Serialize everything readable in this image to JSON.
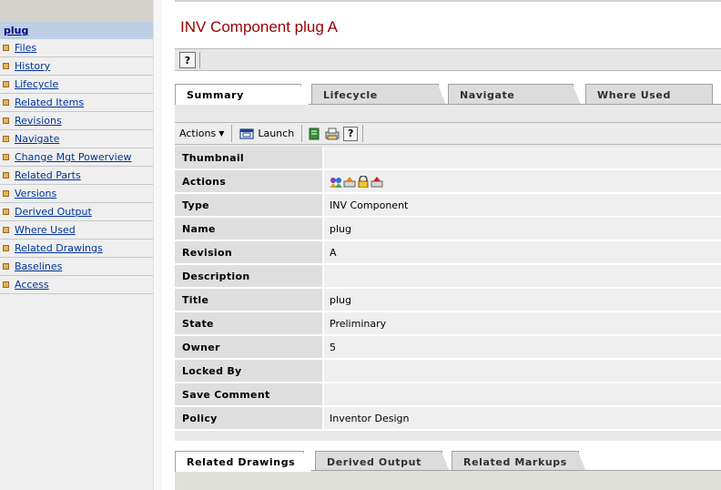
{
  "sidebar": {
    "object_link": "plug",
    "items": [
      {
        "label": "Files"
      },
      {
        "label": "History"
      },
      {
        "label": "Lifecycle"
      },
      {
        "label": "Related Items "
      },
      {
        "label": "Revisions"
      },
      {
        "label": "Navigate"
      },
      {
        "label": "Change Mgt Powerview"
      },
      {
        "label": "Related Parts"
      },
      {
        "label": "Versions"
      },
      {
        "label": "Derived Output"
      },
      {
        "label": "Where Used"
      },
      {
        "label": "Related Drawings"
      },
      {
        "label": "Baselines"
      },
      {
        "label": "Access"
      }
    ]
  },
  "page": {
    "title": "INV Component plug A",
    "help_icon": "help-icon"
  },
  "top_tabs": [
    {
      "label": "Summary",
      "active": true
    },
    {
      "label": "Lifecycle",
      "active": false
    },
    {
      "label": "Navigate",
      "active": false
    },
    {
      "label": "Where Used",
      "active": false
    }
  ],
  "action_bar": {
    "actions_label": "Actions",
    "launch_label": "Launch",
    "icons": [
      "bookmark-icon",
      "print-icon",
      "help-icon"
    ]
  },
  "properties": [
    {
      "label": "Thumbnail",
      "value": ""
    },
    {
      "label": "Actions",
      "value": ""
    },
    {
      "label": "Type",
      "value": "INV Component"
    },
    {
      "label": "Name",
      "value": "plug"
    },
    {
      "label": "Revision",
      "value": "A"
    },
    {
      "label": "Description",
      "value": ""
    },
    {
      "label": "Title",
      "value": "plug"
    },
    {
      "label": "State",
      "value": "Preliminary"
    },
    {
      "label": "Owner",
      "value": "5"
    },
    {
      "label": "Locked By",
      "value": ""
    },
    {
      "label": "Save Comment",
      "value": ""
    },
    {
      "label": "Policy",
      "value": "Inventor Design"
    }
  ],
  "bottom_tabs": [
    {
      "label": "Related Drawings",
      "active": true
    },
    {
      "label": "Derived Output",
      "active": false
    },
    {
      "label": "Related Markups",
      "active": false
    }
  ],
  "colors": {
    "title": "#990000",
    "link": "#003399",
    "selected_nav": "#bccfe4",
    "bullet": "#e3b25a"
  }
}
